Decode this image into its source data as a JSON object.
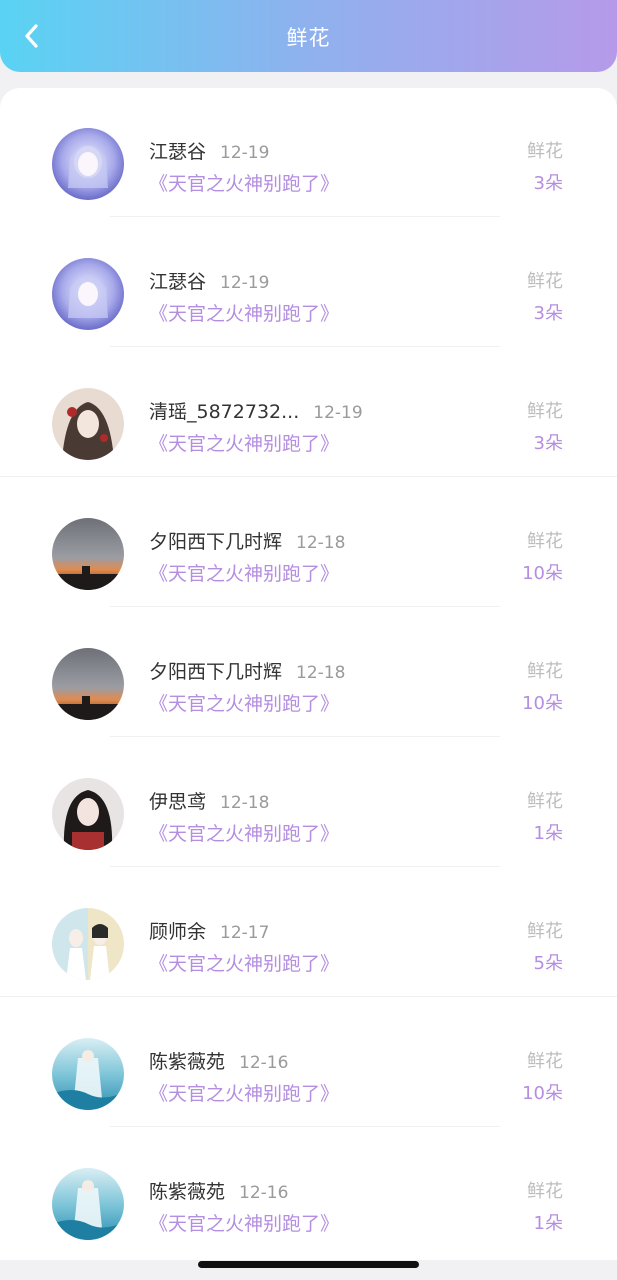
{
  "header": {
    "title": "鲜花",
    "back_icon": "chevron-left-icon",
    "gradient": [
      "#59d3f3",
      "#b69ae9"
    ]
  },
  "records": [
    {
      "name": "江瑟谷",
      "date": "12-19",
      "book": "《天官之火神别跑了》",
      "type": "鲜花",
      "count": "3朵"
    },
    {
      "name": "江瑟谷",
      "date": "12-19",
      "book": "《天官之火神别跑了》",
      "type": "鲜花",
      "count": "3朵"
    },
    {
      "name": "清瑶_5872732...",
      "date": "12-19",
      "book": "《天官之火神别跑了》",
      "type": "鲜花",
      "count": "3朵"
    },
    {
      "name": "夕阳西下几时辉",
      "date": "12-18",
      "book": "《天官之火神别跑了》",
      "type": "鲜花",
      "count": "10朵"
    },
    {
      "name": "夕阳西下几时辉",
      "date": "12-18",
      "book": "《天官之火神别跑了》",
      "type": "鲜花",
      "count": "10朵"
    },
    {
      "name": "伊思鸢",
      "date": "12-18",
      "book": "《天官之火神别跑了》",
      "type": "鲜花",
      "count": "1朵"
    },
    {
      "name": "顾师余",
      "date": "12-17",
      "book": "《天官之火神别跑了》",
      "type": "鲜花",
      "count": "5朵"
    },
    {
      "name": "陈紫薇苑",
      "date": "12-16",
      "book": "《天官之火神别跑了》",
      "type": "鲜花",
      "count": "10朵"
    },
    {
      "name": "陈紫薇苑",
      "date": "12-16",
      "book": "《天官之火神别跑了》",
      "type": "鲜花",
      "count": "1朵"
    }
  ],
  "colors": {
    "accent": "#b48ee0",
    "name": "#333333",
    "muted": "#9a9a9a"
  }
}
